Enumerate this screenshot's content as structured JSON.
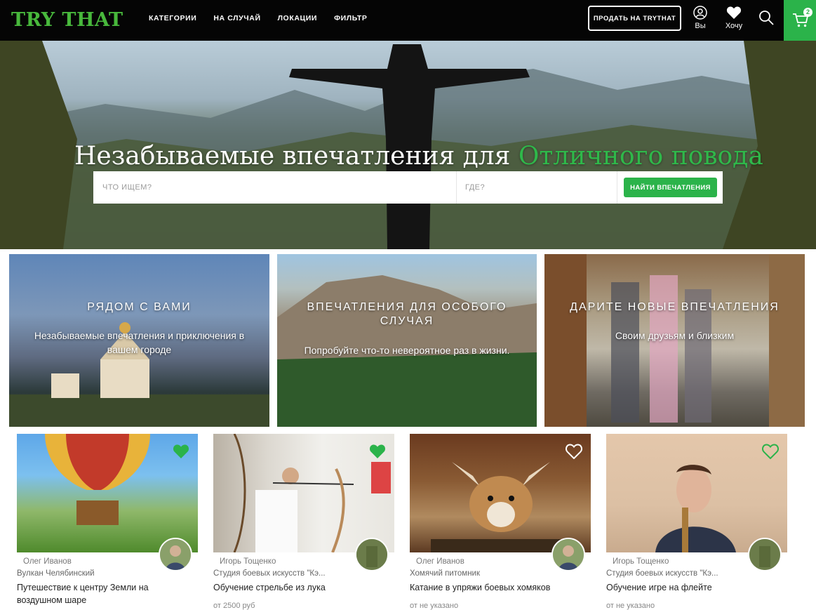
{
  "header": {
    "logo": "TRY THAT",
    "nav": [
      "КАТЕГОРИИ",
      "НА СЛУЧАЙ",
      "ЛОКАЦИИ",
      "ФИЛЬТР"
    ],
    "sell_button": "ПРОДАТЬ НА TRYTHAT",
    "profile_label": "Вы",
    "wishlist_label": "Хочу",
    "cart_count": "2"
  },
  "hero": {
    "title_main": "Незабываемые впечатления для",
    "title_accent": "Отличного повода",
    "search_what_placeholder": "ЧТО ИЩЕМ?",
    "search_where_placeholder": "ГДЕ?",
    "find_button": "НАЙТИ ВПЕЧАТЛЕНИЯ"
  },
  "tiles": [
    {
      "title": "РЯДОМ С ВАМИ",
      "subtitle": "Незабываемые впечатления и приключения в вашем городе"
    },
    {
      "title": "ВПЕЧАТЛЕНИЯ ДЛЯ ОСОБОГО СЛУЧАЯ",
      "subtitle": "Попробуйте что-то невероятное раз в жизни."
    },
    {
      "title": "ДАРИТЕ НОВЫЕ ВПЕЧАТЛЕНИЯ",
      "subtitle": "Своим друзьям и близким"
    }
  ],
  "cards": [
    {
      "author": "Олег Иванов",
      "place": "Вулкан Челябинский",
      "title": "Путешествие к центру Земли на воздушном шаре",
      "price": "",
      "favorited": true
    },
    {
      "author": "Игорь Тощенко",
      "place": "Студия боевых искусств \"Кэ...",
      "title": "Обучение стрельбе из лука",
      "price": "от 2500 руб",
      "favorited": true
    },
    {
      "author": "Олег Иванов",
      "place": "Хомячий питомник",
      "title": "Катание в упряжи боевых хомяков",
      "price": "от не указано",
      "favorited": false
    },
    {
      "author": "Игорь Тощенко",
      "place": "Студия боевых искусств \"Кэ...",
      "title": "Обучение игре на флейте",
      "price": "от не указано",
      "favorited": false
    }
  ],
  "colors": {
    "accent": "#2bb34a",
    "header_bg": "#050505",
    "logo": "#48b83c"
  }
}
